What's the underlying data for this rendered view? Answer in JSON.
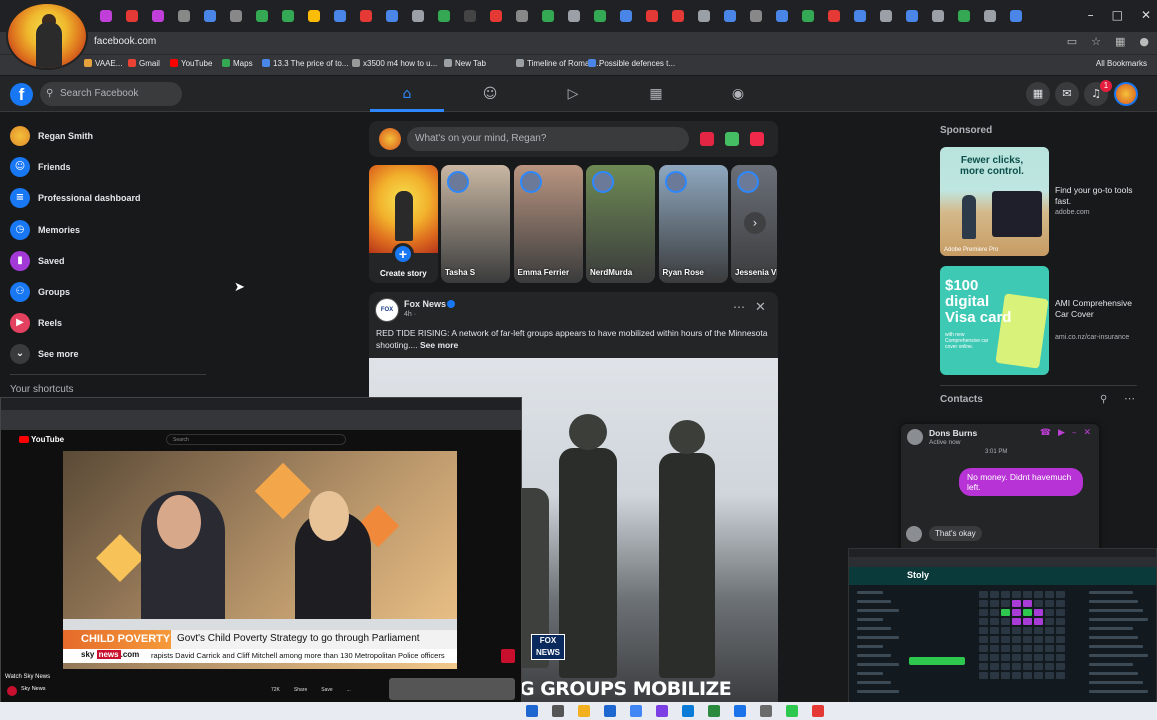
{
  "browser": {
    "url": "facebook.com",
    "bookmarks": [
      {
        "label": "VAAE...",
        "color": "#e6a23c"
      },
      {
        "label": "Gmail",
        "color": "#ea4335"
      },
      {
        "label": "YouTube",
        "color": "#ff0000"
      },
      {
        "label": "Maps",
        "color": "#34a853"
      },
      {
        "label": "13.3 The price of to...",
        "color": "#4a86e8"
      },
      {
        "label": "x3500 m4 how to u...",
        "color": "#999999"
      },
      {
        "label": "New Tab",
        "color": "#9aa0a6"
      },
      {
        "label": "Timeline of Roman...",
        "color": "#9aa0a6"
      },
      {
        "label": "Possible defences t...",
        "color": "#4a86e8"
      }
    ],
    "all_bookmarks": "All Bookmarks"
  },
  "fb": {
    "search_placeholder": "Search Facebook",
    "notification_count": "1"
  },
  "left_nav": [
    {
      "label": "Regan Smith",
      "icon": "user-avatar",
      "color": "#e0892c"
    },
    {
      "label": "Friends",
      "icon": "friends-icon",
      "color": "#1877f2"
    },
    {
      "label": "Professional dashboard",
      "icon": "dashboard-icon",
      "color": "#1877f2"
    },
    {
      "label": "Memories",
      "icon": "clock-icon",
      "color": "#1877f2"
    },
    {
      "label": "Saved",
      "icon": "bookmark-icon",
      "color": "#a33ad8"
    },
    {
      "label": "Groups",
      "icon": "groups-icon",
      "color": "#1877f2"
    },
    {
      "label": "Reels",
      "icon": "reels-icon",
      "color": "#e4405f"
    },
    {
      "label": "See more",
      "icon": "chevron-down-icon",
      "color": "#3a3b3c"
    }
  ],
  "shortcuts_header": "Your shortcuts",
  "composer": {
    "placeholder": "What's on your mind, Regan?"
  },
  "stories": {
    "create_label": "Create story",
    "items": [
      {
        "name": "Tasha S",
        "bg": "#c9b7a3"
      },
      {
        "name": "Emma Ferrier",
        "bg": "#b99580"
      },
      {
        "name": "NerdMurda",
        "bg": "#6e8a54"
      },
      {
        "name": "Ryan Rose",
        "bg": "#8fa8bf"
      },
      {
        "name": "Jessenia Vi",
        "bg": "#6a6f78"
      }
    ]
  },
  "post": {
    "author": "Fox News",
    "time": "4h · ",
    "text": "RED TIDE RISING: A network of far-left groups appears to have mobilized within hours of the Minnesota shooting.... ",
    "see_more": "See more",
    "image_logo": "FOX NEWS",
    "image_headline": "G GROUPS MOBILIZE"
  },
  "sponsored": {
    "header": "Sponsored",
    "ads": [
      {
        "title": "Find your go-to tools fast.",
        "domain": "adobe.com",
        "image_text": "Fewer clicks, more control.",
        "image_footer": "Adobe Premiere Pro"
      },
      {
        "title": "AMI Comprehensive Car Cover",
        "domain": "ami.co.nz/car-insurance",
        "image_text": "$100 digital Visa card",
        "image_footer": "with new Comprehensive car cover online."
      }
    ]
  },
  "contacts": {
    "header": "Contacts"
  },
  "chat": {
    "name": "Dons Burns",
    "status": "Active now",
    "time": "3:01 PM",
    "message": "No money. Didnt havemuch left.",
    "reply": "That's okay"
  },
  "youtube": {
    "logo": "YouTube",
    "search_placeholder": "Search",
    "lower_third_label": "CHILD POVERTY",
    "lower_third_headline": "Govt's Child Poverty Strategy to go through Parliament",
    "ticker_brand_a": "sky ",
    "ticker_brand_b": "news",
    "ticker_brand_c": ".com",
    "ticker_text": "rapists David Carrick and Cliff Mitchell among more than 130 Metropolitan Police officers",
    "watch_label": "Watch Sky News",
    "channel": "Sky News",
    "actions": [
      "72K",
      "Share",
      "Save",
      "..."
    ]
  },
  "mini_window": {
    "app_name": "Stoly"
  },
  "colors": {
    "fb_blue": "#1877f2",
    "fb_bg": "#18191a",
    "card_bg": "#242526",
    "chat_purple": "#b833d6"
  }
}
